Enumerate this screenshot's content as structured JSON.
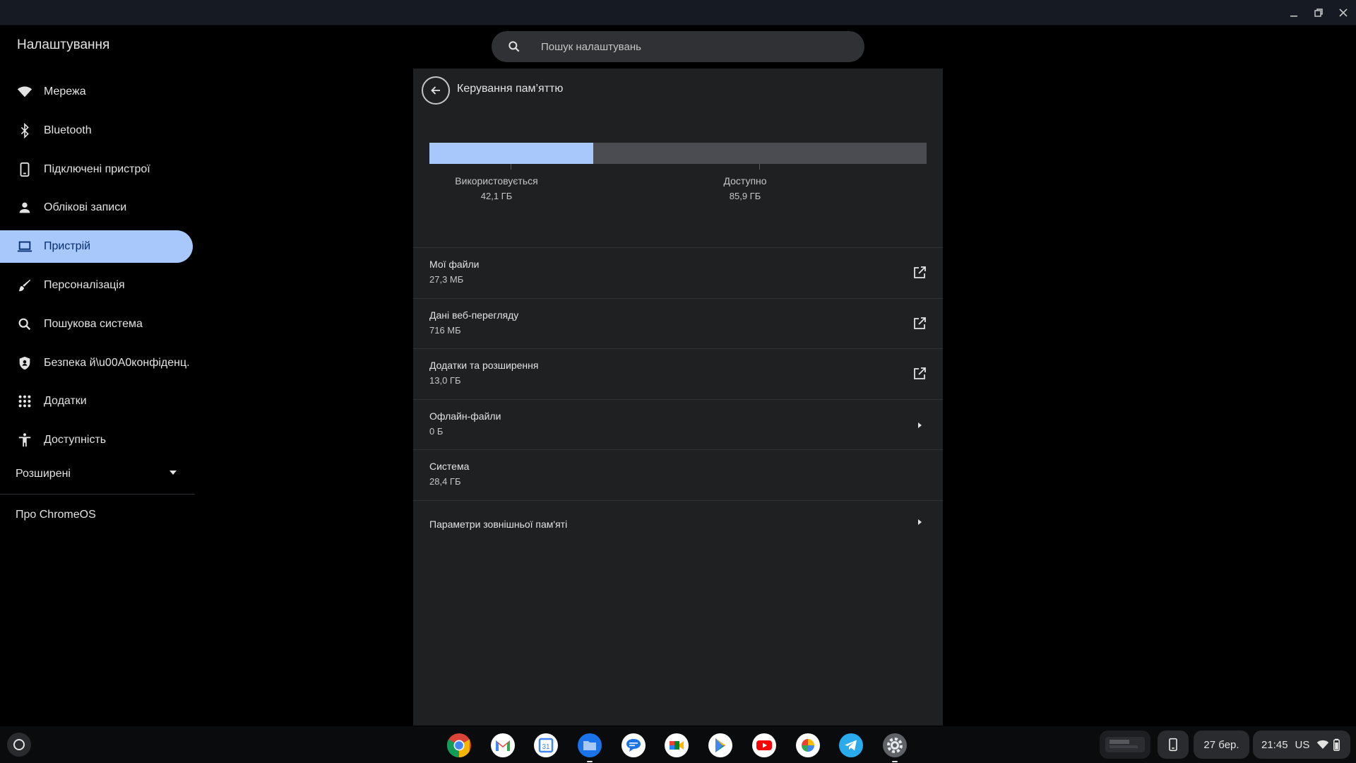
{
  "app": {
    "title": "Налаштування"
  },
  "search": {
    "placeholder": "Пошук налаштувань"
  },
  "sidebar": {
    "items": [
      {
        "label": "Мережа",
        "icon": "wifi-icon"
      },
      {
        "label": "Bluetooth",
        "icon": "bluetooth-icon"
      },
      {
        "label": "Підключені пристрої",
        "icon": "phone-icon"
      },
      {
        "label": "Облікові записи",
        "icon": "person-icon"
      },
      {
        "label": "Пристрій",
        "icon": "laptop-icon",
        "active": true
      },
      {
        "label": "Персоналізація",
        "icon": "brush-icon"
      },
      {
        "label": "Пошукова система",
        "icon": "search-icon"
      },
      {
        "label": "Безпека й\\u00A0конфіденц.",
        "icon": "shield-icon"
      },
      {
        "label": "Додатки",
        "icon": "apps-grid-icon"
      },
      {
        "label": "Доступність",
        "icon": "accessibility-icon"
      }
    ],
    "advanced": "Розширені",
    "about": "Про ChromeOS"
  },
  "page": {
    "title": "Керування пам’яттю",
    "storage": {
      "used_fraction": 0.329,
      "used_label": "Використовується",
      "used_value": "42,1 ГБ",
      "available_label": "Доступно",
      "available_value": "85,9 ГБ"
    },
    "rows": [
      {
        "title": "Мої файли",
        "value": "27,3 МБ",
        "icon": "open-in-new-icon"
      },
      {
        "title": "Дані веб-перегляду",
        "value": "716 МБ",
        "icon": "open-in-new-icon"
      },
      {
        "title": "Додатки та розширення",
        "value": "13,0 ГБ",
        "icon": "open-in-new-icon"
      },
      {
        "title": "Офлайн-файли",
        "value": "0 Б",
        "icon": "arrow-right-icon"
      },
      {
        "title": "Система",
        "value": "28,4 ГБ",
        "icon": ""
      },
      {
        "title": "Параметри зовнішньої пам'яті",
        "value": "",
        "icon": "arrow-right-icon"
      }
    ]
  },
  "shelf": {
    "apps": [
      "chrome-icon",
      "gmail-icon",
      "calendar-icon",
      "files-icon",
      "messages-icon",
      "meet-icon",
      "play-store-icon",
      "youtube-icon",
      "photos-icon",
      "telegram-icon",
      "settings-icon"
    ],
    "calendar_day": "31",
    "date": "27 бер.",
    "time": "21:45",
    "ime": "US"
  },
  "colors": {
    "accent": "#a8c7fa",
    "card": "#1f2022",
    "background": "#000000"
  }
}
